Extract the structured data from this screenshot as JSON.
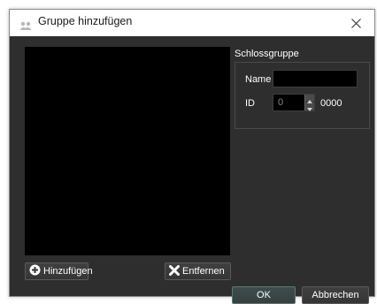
{
  "window": {
    "title": "Gruppe hinzufügen",
    "icon": "group-icon",
    "close_icon": "close-icon"
  },
  "left_panel": {
    "viewport_color": "#000000",
    "add_button": {
      "label": "Hinzufügen",
      "icon": "plus-circle-icon"
    },
    "remove_button": {
      "label": "Entfernen",
      "icon": "x-icon"
    }
  },
  "group": {
    "title": "Schlossgruppe",
    "name_label": "Name",
    "name_value": "",
    "id_label": "ID",
    "id_value": "0",
    "id_hex": "0000"
  },
  "footer": {
    "ok_label": "OK",
    "cancel_label": "Abbrechen"
  },
  "colors": {
    "background": "#2e2e2e",
    "input_background": "#000000",
    "text": "#ffffff",
    "ok_accent": "#5e7876"
  }
}
